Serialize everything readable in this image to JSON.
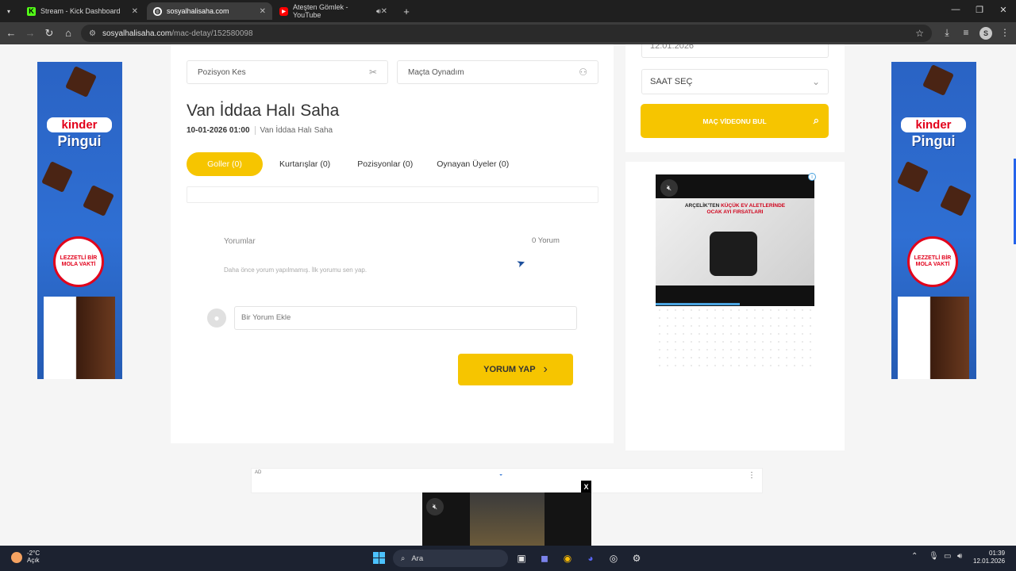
{
  "browser": {
    "tabs": [
      {
        "title": "Stream - Kick Dashboard",
        "active": false
      },
      {
        "title": "sosyalhalisaha.com",
        "active": true
      },
      {
        "title": "Ateşten Gömlek - YouTube",
        "active": false
      }
    ],
    "url_host": "sosyalhalisaha.com",
    "url_path": "/mac-detay/152580098",
    "profile_initial": "S"
  },
  "form": {
    "cut_position": "Pozisyon Kes",
    "played_in_match": "Maçta Oynadım"
  },
  "match": {
    "title": "Van İddaa Halı Saha",
    "datetime": "10-01-2026 01:00",
    "venue": "Van İddaa Halı Saha"
  },
  "tabs": [
    {
      "label": "Goller (0)",
      "active": true
    },
    {
      "label": "Kurtarışlar (0)",
      "active": false
    },
    {
      "label": "Pozisyonlar (0)",
      "active": false
    },
    {
      "label": "Oynayan Üyeler (0)",
      "active": false
    }
  ],
  "comments": {
    "heading": "Yorumlar",
    "count": "0 Yorum",
    "empty_text": "Daha önce yorum yapılmamış. İlk yorumu sen yap.",
    "input_placeholder": "Bir Yorum Ekle",
    "submit_label": "YORUM YAP"
  },
  "sidebar": {
    "date_value": "12.01.2026",
    "time_select": "SAAT SEÇ",
    "find_button": "MAÇ VİDEONU BUL"
  },
  "ads": {
    "kinder_brand": "kinder",
    "kinder_product": "Pingui",
    "kinder_slogan": "LEZZETLİ BİR MOLA VAKTİ",
    "video_headline_1": "ARÇELİK'TEN",
    "video_headline_2": "KÜÇÜK EV ALETLERİNDE",
    "video_headline_3": "OCAK AYI FIRSATLARI",
    "bottom_ad_tag": "AD",
    "sticky_close": "X"
  },
  "taskbar": {
    "temperature": "-2°C",
    "condition": "Açık",
    "search_label": "Ara",
    "time": "01:39",
    "date": "12.01.2026"
  },
  "colors": {
    "accent_yellow": "#f6c500",
    "browser_dark": "#1f1f1f",
    "taskbar": "#1c2230"
  }
}
